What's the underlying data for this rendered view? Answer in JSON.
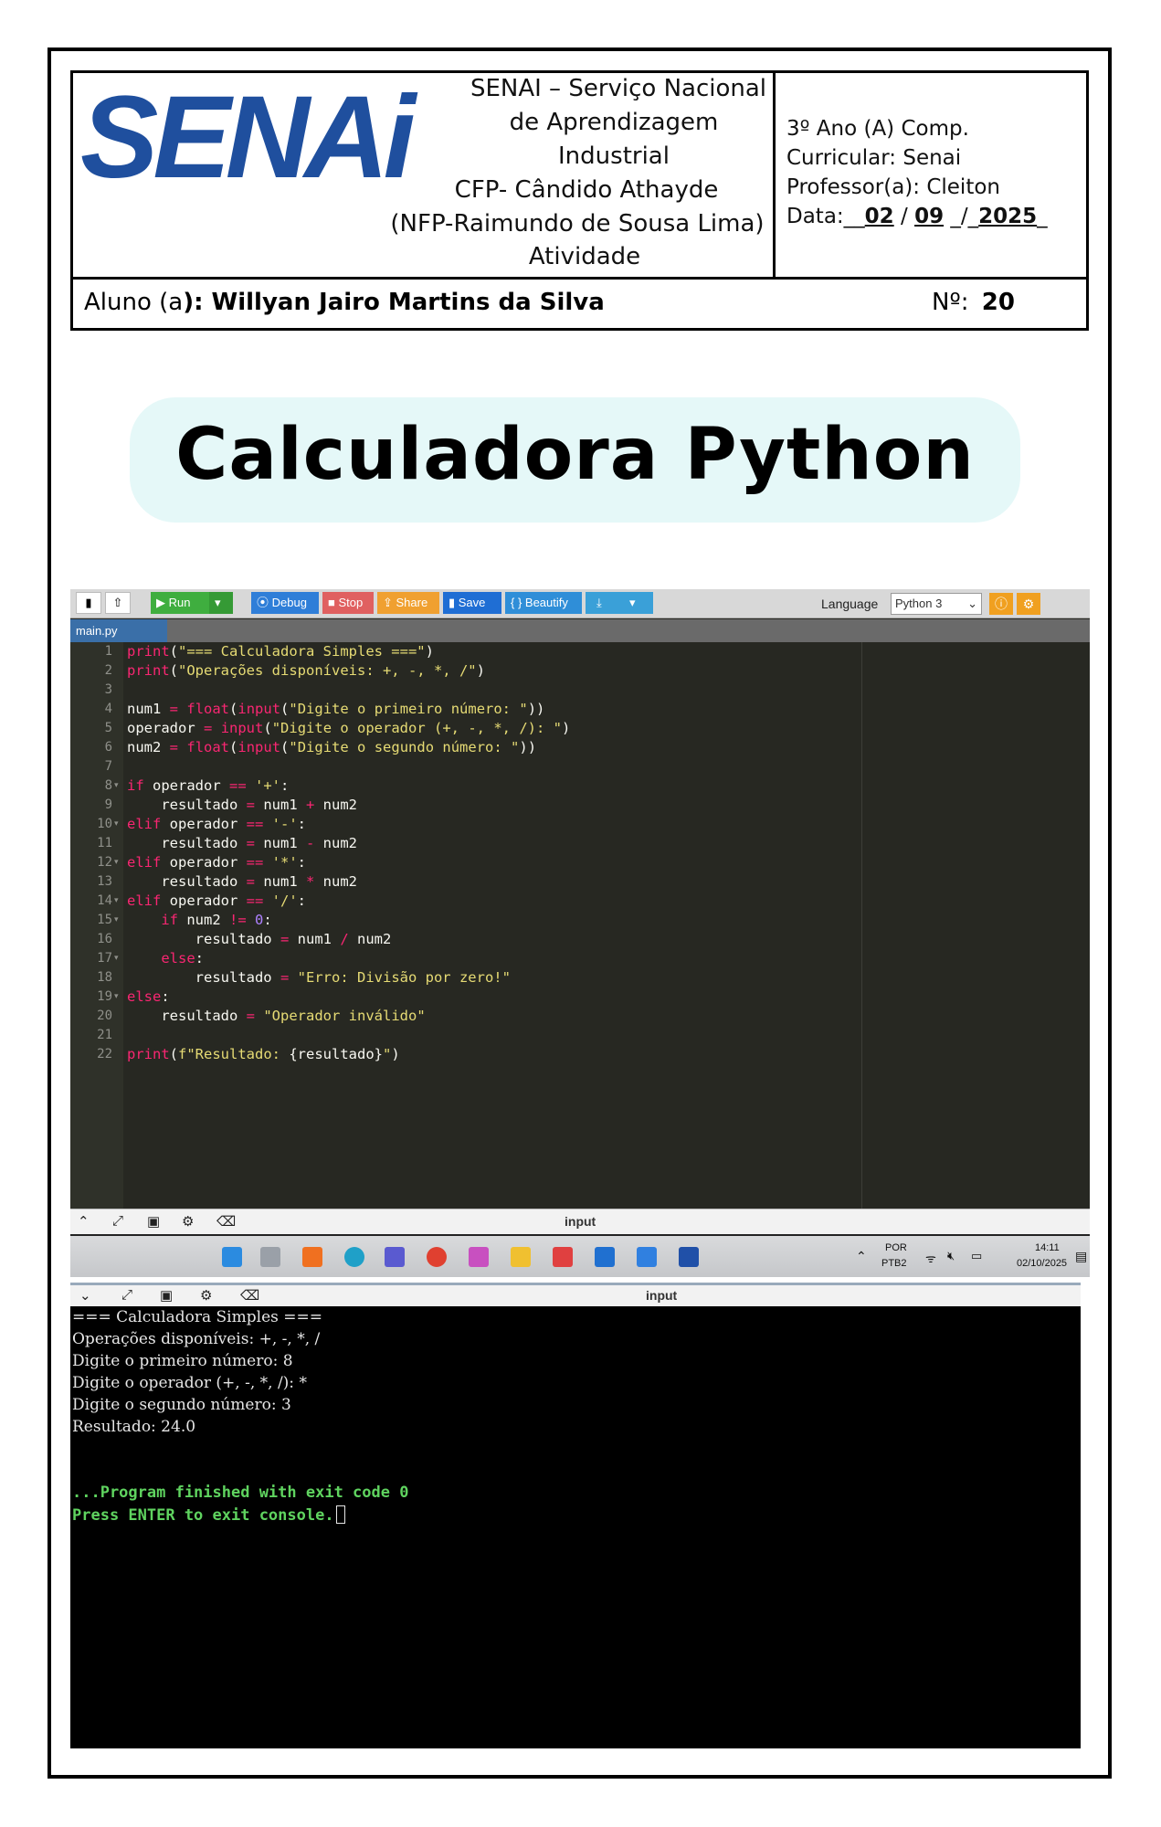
{
  "header": {
    "logo_text": "SENAi",
    "institution": [
      "SENAI – Serviço Nacional",
      "de Aprendizagem",
      "Industrial",
      "CFP- Cândido Athayde",
      "(NFP-Raimundo de Sousa Lima)",
      "Atividade"
    ],
    "class_line": "3º Ano (A) Comp.",
    "curricular": "Curricular: Senai",
    "teacher": "Professor(a): Cleiton",
    "date_label": "Data:__",
    "date_day": "02",
    "date_sep1": " / ",
    "date_month": "09",
    "date_sep2": " _/_",
    "date_year": "2025",
    "date_tail": "_",
    "student_label": "Aluno (a",
    "student_name": "): Willyan Jairo Martins da Silva",
    "number_label": "Nº:",
    "number_value": "20"
  },
  "title": "Calculadora Python",
  "ide": {
    "buttons": {
      "run": "▶ Run",
      "debug": "⦿ Debug",
      "stop": "■ Stop",
      "share": "⇪ Share",
      "save": "▮ Save",
      "beautify": "{ } Beautify"
    },
    "language_label": "Language",
    "language_value": "Python 3",
    "tab": "main.py",
    "bottom_label": "input",
    "colors": {
      "run": "#3fae3f",
      "debug": "#2f7ed8",
      "stop": "#e06060",
      "share": "#f0a030",
      "save": "#1f6ed4",
      "beautify": "#2f8ed8",
      "download": "#3aa0d8"
    }
  },
  "taskbar": {
    "lang_top": "POR",
    "lang_bottom": "PTB2",
    "time": "14:11",
    "date": "02/10/2025"
  },
  "console": {
    "top_label": "input",
    "lines": [
      "=== Calculadora Simples ===",
      "Operações disponíveis: +, -, *, /",
      "Digite o primeiro número: 8",
      "Digite o operador (+, -, *, /): *",
      "Digite o segundo número: 3",
      "Resultado: 24.0"
    ],
    "finish_line": "...Program finished with exit code 0",
    "press_line": "Press ENTER to exit console."
  }
}
